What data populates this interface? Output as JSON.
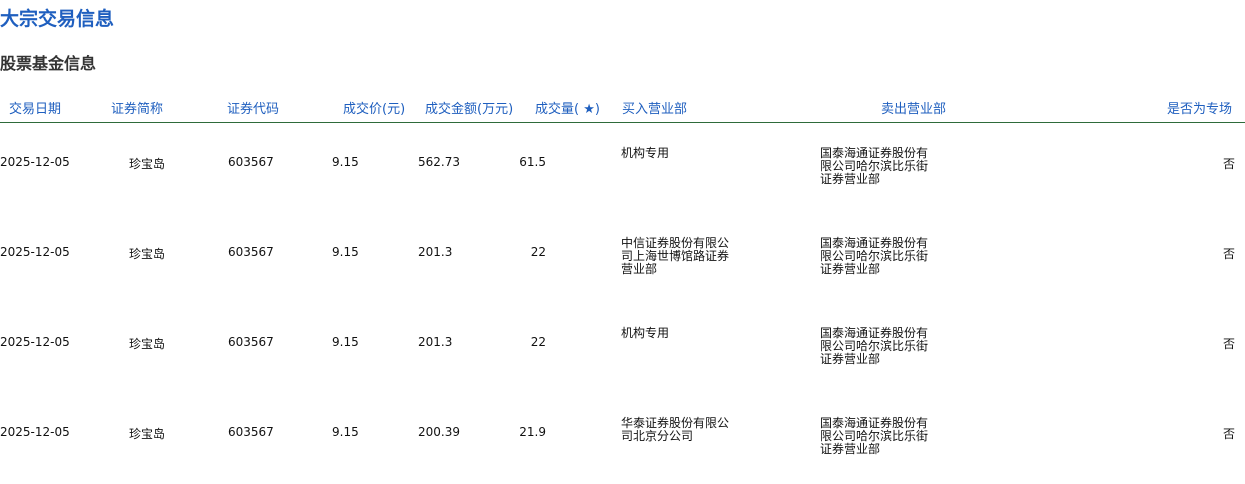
{
  "page": {
    "title": "大宗交易信息",
    "section": "股票基金信息"
  },
  "table": {
    "headers": [
      "交易日期",
      "证券简称",
      "证券代码",
      "成交价(元)",
      "成交金额(万元)",
      "成交量( ★)",
      "买入营业部",
      "卖出营业部",
      "是否为专场"
    ],
    "rows": [
      {
        "date": "2025-12-05",
        "name": "珍宝岛",
        "code": "603567",
        "price": "9.15",
        "amount": "562.73",
        "volume": "61.5",
        "buyer": "机构专用",
        "seller": "国泰海通证券股份有限公司哈尔滨比乐街证券营业部",
        "special": "否"
      },
      {
        "date": "2025-12-05",
        "name": "珍宝岛",
        "code": "603567",
        "price": "9.15",
        "amount": "201.3",
        "volume": "22",
        "buyer": "中信证券股份有限公司上海世博馆路证券营业部",
        "seller": "国泰海通证券股份有限公司哈尔滨比乐街证券营业部",
        "special": "否"
      },
      {
        "date": "2025-12-05",
        "name": "珍宝岛",
        "code": "603567",
        "price": "9.15",
        "amount": "201.3",
        "volume": "22",
        "buyer": "机构专用",
        "seller": "国泰海通证券股份有限公司哈尔滨比乐街证券营业部",
        "special": "否"
      },
      {
        "date": "2025-12-05",
        "name": "珍宝岛",
        "code": "603567",
        "price": "9.15",
        "amount": "200.39",
        "volume": "21.9",
        "buyer": "华泰证券股份有限公司北京分公司",
        "seller": "国泰海通证券股份有限公司哈尔滨比乐街证券营业部",
        "special": "否"
      }
    ]
  }
}
